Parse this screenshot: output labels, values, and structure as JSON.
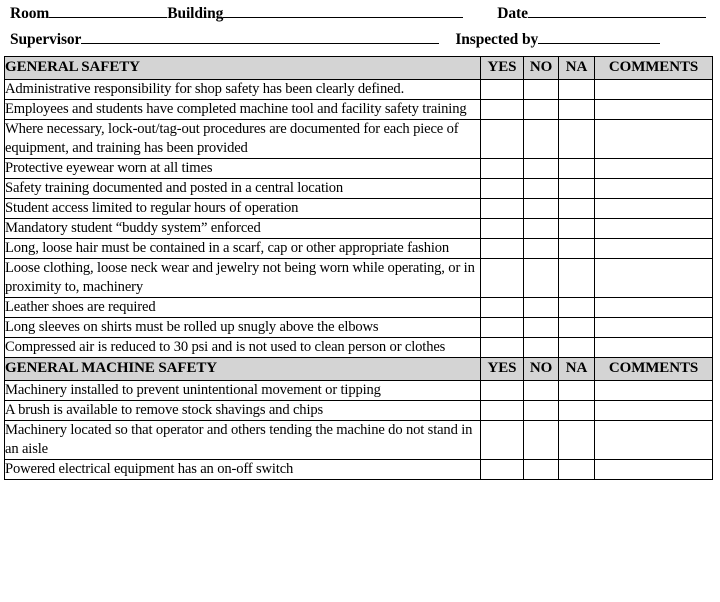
{
  "form": {
    "fields": [
      {
        "label": "Room",
        "name": "room-field"
      },
      {
        "label": "Building",
        "name": "building-field"
      },
      {
        "label": "Date",
        "name": "date-field"
      },
      {
        "label": "Supervisor",
        "name": "supervisor-field"
      },
      {
        "label": "Inspected by",
        "name": "inspected-by-field"
      }
    ]
  },
  "table": {
    "columns": {
      "item": "",
      "yes": "YES",
      "no": "NO",
      "na": "NA",
      "comments": "COMMENTS"
    },
    "header_background": "#d4d4d4",
    "sections": [
      {
        "title": "GENERAL SAFETY",
        "items": [
          "Administrative responsibility for shop safety has been clearly defined.",
          "Employees and students have completed machine tool and facility safety training",
          "Where necessary, lock-out/tag-out procedures are documented for each piece of equipment, and training has been provided",
          "Protective eyewear worn at all times",
          "Safety training documented and posted in a central location",
          "Student access limited to regular hours of operation",
          "Mandatory student “buddy system” enforced",
          "Long, loose hair must be contained in a scarf, cap or other appropriate fashion",
          "Loose clothing, loose neck wear and jewelry not being worn while operating, or in proximity to, machinery",
          "Leather shoes are required",
          "Long sleeves on shirts must be rolled up snugly above the elbows",
          "Compressed air is reduced to 30 psi and is not used to clean person or clothes"
        ]
      },
      {
        "title": "GENERAL MACHINE SAFETY",
        "items": [
          "Machinery installed to prevent unintentional movement or tipping",
          "A brush is available to remove stock shavings and chips",
          "Machinery located so that operator and others tending the machine do not stand in an aisle",
          "Powered electrical equipment has an on-off switch"
        ]
      }
    ]
  }
}
